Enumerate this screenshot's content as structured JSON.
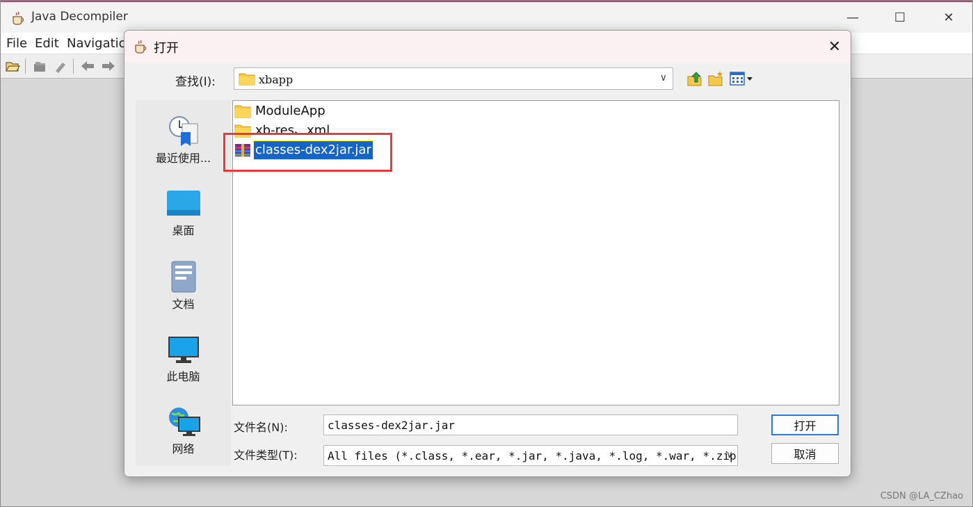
{
  "window": {
    "title": "Java Decompiler",
    "controls": {
      "minimize": "—",
      "maximize": "☐",
      "close": "✕"
    }
  },
  "menu": {
    "items": [
      "File",
      "Edit",
      "Navigatio"
    ]
  },
  "dialog": {
    "title": "打开",
    "close": "✕",
    "look_in_label": "查找(I):",
    "look_in_value": "xbapp",
    "places": [
      {
        "label": "最近使用...",
        "icon": "recent-items-icon"
      },
      {
        "label": "桌面",
        "icon": "desktop-icon"
      },
      {
        "label": "文档",
        "icon": "documents-icon"
      },
      {
        "label": "此电脑",
        "icon": "computer-icon"
      },
      {
        "label": "网络",
        "icon": "network-icon"
      }
    ],
    "files": [
      {
        "name": "ModuleApp",
        "type": "folder"
      },
      {
        "name": "xb-res、xml",
        "type": "folder"
      },
      {
        "name": "classes-dex2jar.jar",
        "type": "jar-archive",
        "selected": true
      }
    ],
    "file_name_label": "文件名(N):",
    "file_name_value": "classes-dex2jar.jar",
    "file_type_label": "文件类型(T):",
    "file_type_value": "All files (*.class, *.ear, *.jar, *.java, *.log, *.war, *.zip)",
    "open_button": "打开",
    "cancel_button": "取消"
  },
  "watermark": "CSDN @LA_CZhao",
  "colors": {
    "selection": "#1565c8",
    "annotation_box": "#e8393b",
    "title_accent": "#c0416a"
  }
}
